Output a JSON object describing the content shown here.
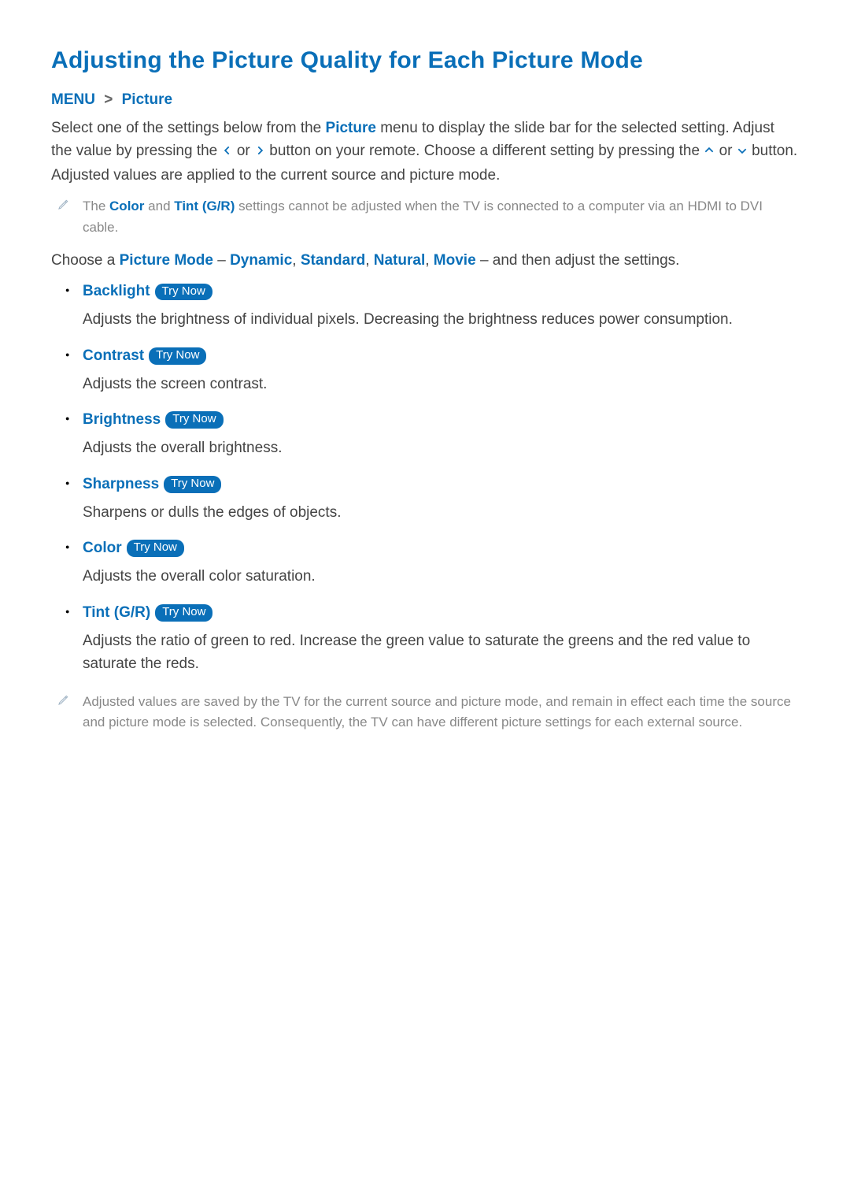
{
  "title": "Adjusting the Picture Quality for Each Picture Mode",
  "breadcrumb": {
    "menu": "MENU",
    "picture": "Picture"
  },
  "intro": {
    "pre": "Select one of the settings below from the ",
    "picture_word": "Picture",
    "mid1": " menu to display the slide bar for the selected setting. Adjust the value by pressing the ",
    "left": "‹",
    "or1": " or ",
    "right": "›",
    "mid2": " button on your remote. Choose a different setting by pressing the ",
    "up": "˄",
    "or2": " or ",
    "down": "˅",
    "post": " button. Adjusted values are applied to the current source and picture mode."
  },
  "note1": {
    "pre": "The ",
    "color": "Color",
    "and": " and ",
    "tint": "Tint (G/R)",
    "post": " settings cannot be adjusted when the TV is connected to a computer via an HDMI to DVI cable."
  },
  "choose": {
    "pre": "Choose a ",
    "mode": "Picture Mode",
    "dash1": " – ",
    "m1": "Dynamic",
    "c1": ", ",
    "m2": "Standard",
    "c2": ", ",
    "m3": "Natural",
    "c3": ", ",
    "m4": "Movie",
    "dash2": " – ",
    "post": "and then adjust the settings."
  },
  "trynow_label": "Try Now",
  "items": [
    {
      "name": "Backlight",
      "desc": "Adjusts the brightness of individual pixels. Decreasing the brightness reduces power consumption."
    },
    {
      "name": "Contrast",
      "desc": "Adjusts the screen contrast."
    },
    {
      "name": "Brightness",
      "desc": "Adjusts the overall brightness."
    },
    {
      "name": "Sharpness",
      "desc": "Sharpens or dulls the edges of objects."
    },
    {
      "name": "Color",
      "desc": "Adjusts the overall color saturation."
    },
    {
      "name": "Tint (G/R)",
      "desc": "Adjusts the ratio of green to red. Increase the green value to saturate the greens and the red value to saturate the reds."
    }
  ],
  "note2": "Adjusted values are saved by the TV for the current source and picture mode, and remain in effect each time the source and picture mode is selected. Consequently, the TV can have different picture settings for each external source."
}
